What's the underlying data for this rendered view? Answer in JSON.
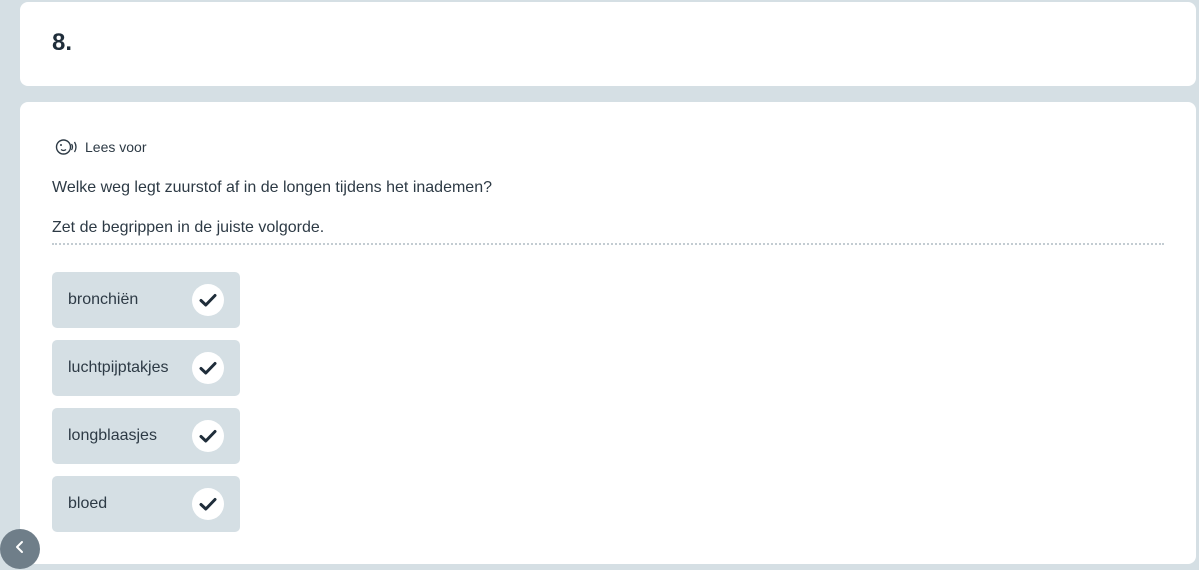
{
  "header": {
    "question_number": "8."
  },
  "question": {
    "read_aloud_label": "Lees voor",
    "text": "Welke weg legt zuurstof af in de longen tijdens het inademen?",
    "instruction": "Zet de begrippen in de juiste volgorde.",
    "items": [
      {
        "label": "bronchiën",
        "status_icon": "check-icon"
      },
      {
        "label": "luchtpijptakjes",
        "status_icon": "check-icon"
      },
      {
        "label": "longblaasjes",
        "status_icon": "check-icon"
      },
      {
        "label": "bloed",
        "status_icon": "check-icon"
      }
    ]
  },
  "navigation": {
    "back_icon": "chevron-left-icon"
  },
  "colors": {
    "background": "#d5dfe4",
    "card": "#ffffff",
    "item_background": "#d5dfe4",
    "text": "#2d3a45",
    "check": "#1f2d3a",
    "nav_button": "#6f7e89"
  }
}
